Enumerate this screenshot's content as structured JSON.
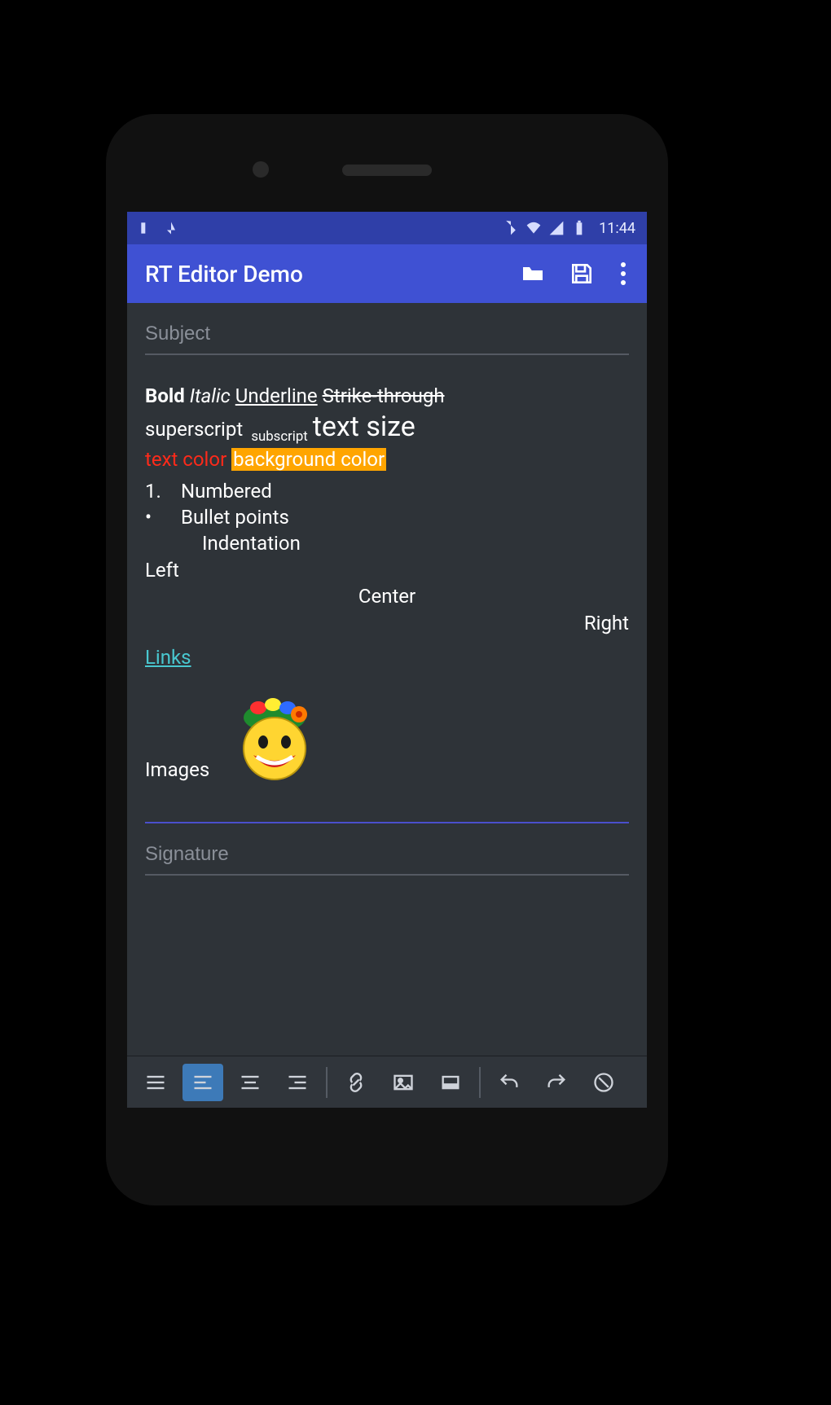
{
  "statusbar": {
    "time": "11:44"
  },
  "appbar": {
    "title": "RT Editor Demo"
  },
  "subject": {
    "placeholder": "Subject",
    "value": ""
  },
  "body": {
    "bold": "Bold",
    "italic": "Italic",
    "underline": "Underline",
    "strike": "Strike-through",
    "superscript": "superscript",
    "subscript": "subscript",
    "textsize": "text size",
    "textcolor": "text color",
    "bgcolor": "background color",
    "list_numbered_marker": "1.",
    "list_numbered": "Numbered",
    "list_bullets": "Bullet points",
    "indentation": "Indentation",
    "left": "Left",
    "center": "Center",
    "right": "Right",
    "links": "Links",
    "images_label": "Images"
  },
  "signature": {
    "placeholder": "Signature",
    "value": ""
  },
  "colors": {
    "accent": "#3f51d3",
    "link": "#49c7cf",
    "textcolor_sample": "#ff2a1a",
    "bgcolor_sample": "#ffa500"
  },
  "toolbar_icons": [
    "align-justify",
    "align-left",
    "align-center",
    "align-right",
    "link",
    "image",
    "color",
    "undo",
    "redo",
    "clear"
  ]
}
